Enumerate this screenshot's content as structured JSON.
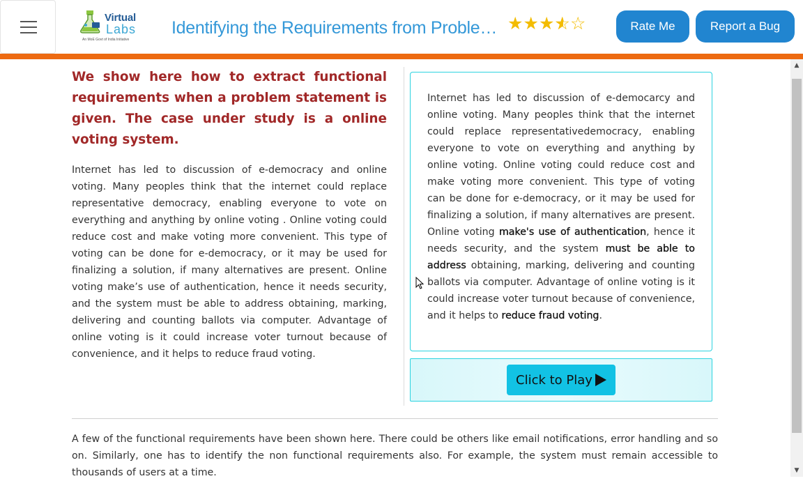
{
  "header": {
    "logo": {
      "word1": "Virtual",
      "word2": "Labs",
      "tagline": "An MoE Govt of India Initiative"
    },
    "title": "Identifying the Requirements from Problem Statements",
    "rating": {
      "value": 3.5,
      "max": 5
    },
    "rate_button": "Rate Me",
    "bug_button": "Report a Bug",
    "accent_color": "#ed6a11",
    "button_color": "#2185d0"
  },
  "main": {
    "heading": "We show here how to extract functional requirements when a problem statement is given. The case under study is a online voting system.",
    "paragraph": "Internet has led to discussion of e-democracy and online voting. Many peoples think that the internet could replace representative democracy, enabling everyone to vote on everything and anything by online voting . Online voting could reduce cost and make voting more convenient. This type of voting can be done for e-democracy, or it may be used for finalizing a solution, if many alternatives are present. Online voting make’s use of authentication, hence it needs security, and the system must be able to address obtaining, marking, delivering and counting ballots via computer. Advantage of online voting is it could increase voter turnout because of convenience, and it helps to reduce fraud voting.",
    "story": {
      "part1": "Internet has led to discussion of e-democarcy and online voting. Many peoples think that the internet could replace representativedemocracy, enabling everyone to vote on everything and anything by online voting. Online voting could reduce cost and make voting more convenient. This type of voting can be done for e-democracy, or it may be used for finalizing a solution, if many alternatives are present. Online voting ",
      "highlight1": "make's use of authentication",
      "part2": ", hence it needs security, and the system ",
      "highlight2": "must be able to address",
      "part3": " obtaining, marking, delivering and counting ballots via computer. Advantage of online voting is it could increase voter turnout because of convenience, and it helps to ",
      "highlight3": "reduce fraud voting",
      "part4": "."
    },
    "play_button": "Click to Play",
    "bottom_paragraph": "A few of the functional requirements have been shown here. There could be others like email notifications, error handling and so on. Similarly, one has to identify the non functional requirements also. For example, the system must remain accessible to thousands of users at a time."
  }
}
